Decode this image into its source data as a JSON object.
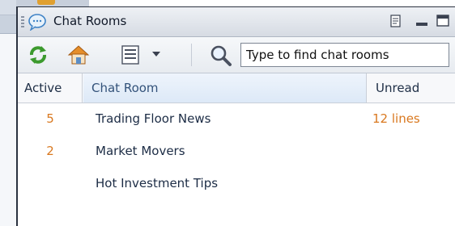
{
  "panel": {
    "title": "Chat Rooms"
  },
  "toolbar": {
    "search_placeholder": "Type to find chat rooms",
    "buttons": [
      "refresh-icon",
      "home-icon",
      "list-view-icon",
      "search-icon"
    ]
  },
  "table": {
    "headers": {
      "active": "Active",
      "room": "Chat Room",
      "unread": "Unread"
    },
    "rows": [
      {
        "active": "5",
        "room": "Trading Floor News",
        "unread": "12 lines"
      },
      {
        "active": "2",
        "room": "Market Movers",
        "unread": ""
      },
      {
        "active": "",
        "room": "Hot Investment Tips",
        "unread": ""
      }
    ]
  },
  "colors": {
    "accent_orange": "#d9781f",
    "header_highlight": "#dde9f7"
  }
}
